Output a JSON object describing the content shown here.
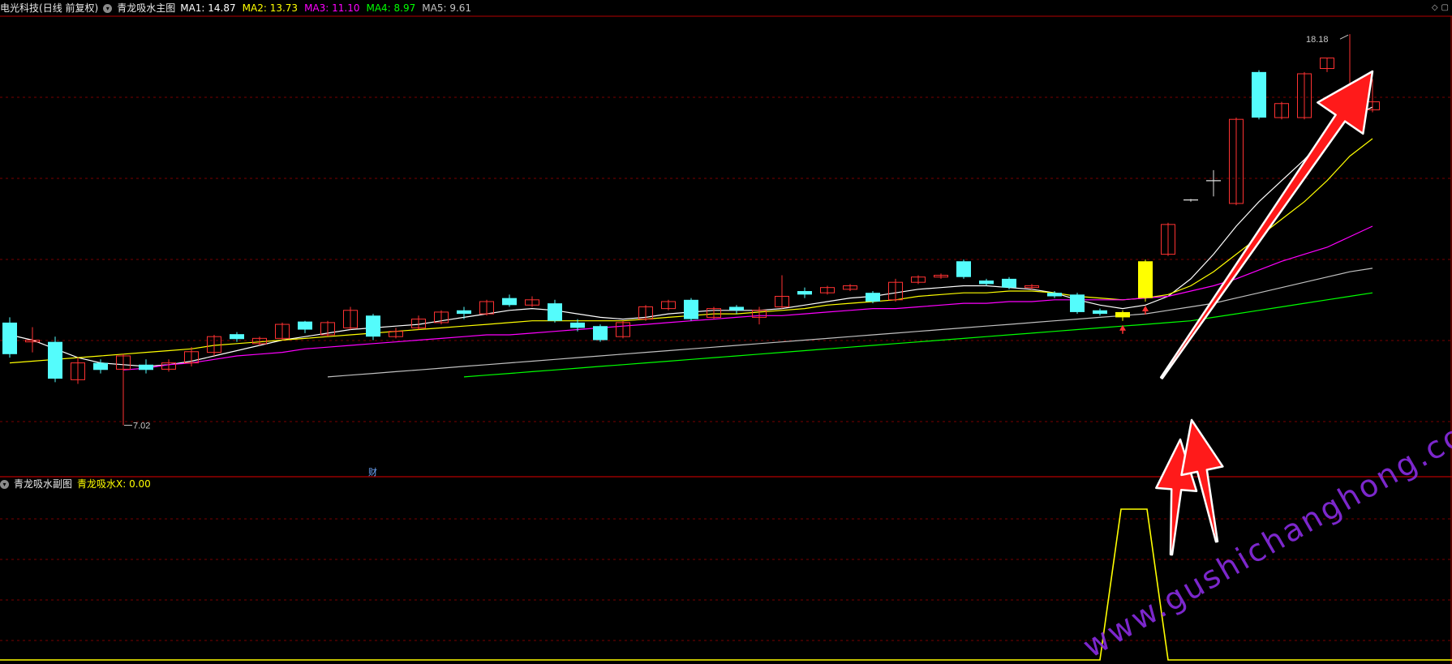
{
  "main_panel": {
    "stock_name": "电光科技",
    "period_label": "(日线 前复权)",
    "indicator_name": "青龙吸水主图",
    "ma_labels": [
      {
        "text": "MA1: 14.87",
        "color": "#ffffff"
      },
      {
        "text": "MA2: 13.73",
        "color": "#ffff00"
      },
      {
        "text": "MA3: 11.10",
        "color": "#ff00ff"
      },
      {
        "text": "MA4: 8.97",
        "color": "#00ff00"
      },
      {
        "text": "MA5: 9.61",
        "color": "#c0c0c0"
      }
    ],
    "high_label": "18.18",
    "low_label": "7.02",
    "finance_marker": "财"
  },
  "sub_panel": {
    "indicator_name": "青龙吸水副图",
    "value_label": "青龙吸水X: 0.00"
  },
  "watermark": "www.gushichanghong.com",
  "colors": {
    "up": "#ff3232",
    "down": "#54fcfc",
    "signal": "#ffff00",
    "grid": "#7a0000",
    "axis": "#b40000"
  },
  "chart_data": {
    "type": "candlestick",
    "price_range": [
      7.02,
      18.18
    ],
    "candles": [
      {
        "o": 9.05,
        "c": 9.95,
        "h": 10.1,
        "l": 8.95,
        "dir": "down"
      },
      {
        "o": 9.4,
        "c": 9.45,
        "h": 9.82,
        "l": 9.1,
        "dir": "up"
      },
      {
        "o": 9.4,
        "c": 8.35,
        "h": 9.55,
        "l": 8.25,
        "dir": "down"
      },
      {
        "o": 8.32,
        "c": 8.8,
        "h": 8.95,
        "l": 8.2,
        "dir": "up"
      },
      {
        "o": 8.8,
        "c": 8.6,
        "h": 8.9,
        "l": 8.5,
        "dir": "down"
      },
      {
        "o": 8.62,
        "c": 9.0,
        "h": 9.05,
        "l": 7.02,
        "dir": "up"
      },
      {
        "o": 8.75,
        "c": 8.6,
        "h": 8.9,
        "l": 8.5,
        "dir": "down"
      },
      {
        "o": 8.62,
        "c": 8.8,
        "h": 8.9,
        "l": 8.55,
        "dir": "up"
      },
      {
        "o": 8.8,
        "c": 9.12,
        "h": 9.25,
        "l": 8.7,
        "dir": "up"
      },
      {
        "o": 9.1,
        "c": 9.55,
        "h": 9.6,
        "l": 9.0,
        "dir": "up"
      },
      {
        "o": 9.62,
        "c": 9.48,
        "h": 9.68,
        "l": 9.4,
        "dir": "down"
      },
      {
        "o": 9.35,
        "c": 9.5,
        "h": 9.55,
        "l": 9.3,
        "dir": "up"
      },
      {
        "o": 9.5,
        "c": 9.9,
        "h": 9.95,
        "l": 9.45,
        "dir": "up"
      },
      {
        "o": 9.98,
        "c": 9.75,
        "h": 10.0,
        "l": 9.65,
        "dir": "down"
      },
      {
        "o": 9.6,
        "c": 9.95,
        "h": 10.0,
        "l": 9.55,
        "dir": "up"
      },
      {
        "o": 9.8,
        "c": 10.3,
        "h": 10.4,
        "l": 9.75,
        "dir": "up"
      },
      {
        "o": 10.15,
        "c": 9.55,
        "h": 10.2,
        "l": 9.45,
        "dir": "down"
      },
      {
        "o": 9.55,
        "c": 9.7,
        "h": 9.8,
        "l": 9.5,
        "dir": "up"
      },
      {
        "o": 9.8,
        "c": 10.05,
        "h": 10.15,
        "l": 9.75,
        "dir": "up"
      },
      {
        "o": 9.95,
        "c": 10.25,
        "h": 10.3,
        "l": 9.9,
        "dir": "up"
      },
      {
        "o": 10.3,
        "c": 10.2,
        "h": 10.4,
        "l": 10.05,
        "dir": "down"
      },
      {
        "o": 10.2,
        "c": 10.55,
        "h": 10.6,
        "l": 10.15,
        "dir": "up"
      },
      {
        "o": 10.65,
        "c": 10.45,
        "h": 10.75,
        "l": 10.4,
        "dir": "down"
      },
      {
        "o": 10.45,
        "c": 10.6,
        "h": 10.7,
        "l": 10.4,
        "dir": "up"
      },
      {
        "o": 10.5,
        "c": 10.0,
        "h": 10.6,
        "l": 9.95,
        "dir": "down"
      },
      {
        "o": 9.8,
        "c": 9.95,
        "h": 10.05,
        "l": 9.7,
        "dir": "down"
      },
      {
        "o": 9.85,
        "c": 9.45,
        "h": 9.9,
        "l": 9.4,
        "dir": "down"
      },
      {
        "o": 9.55,
        "c": 9.95,
        "h": 10.0,
        "l": 9.5,
        "dir": "up"
      },
      {
        "o": 10.05,
        "c": 10.4,
        "h": 10.45,
        "l": 10.0,
        "dir": "up"
      },
      {
        "o": 10.35,
        "c": 10.55,
        "h": 10.6,
        "l": 10.3,
        "dir": "up"
      },
      {
        "o": 10.6,
        "c": 10.05,
        "h": 10.65,
        "l": 10.0,
        "dir": "down"
      },
      {
        "o": 10.1,
        "c": 10.35,
        "h": 10.4,
        "l": 10.05,
        "dir": "up"
      },
      {
        "o": 10.4,
        "c": 10.3,
        "h": 10.45,
        "l": 10.2,
        "dir": "down"
      },
      {
        "o": 10.1,
        "c": 10.3,
        "h": 10.4,
        "l": 9.9,
        "dir": "up"
      },
      {
        "o": 10.4,
        "c": 10.7,
        "h": 11.3,
        "l": 10.35,
        "dir": "up"
      },
      {
        "o": 10.85,
        "c": 10.75,
        "h": 10.95,
        "l": 10.65,
        "dir": "down"
      },
      {
        "o": 10.8,
        "c": 10.95,
        "h": 11.0,
        "l": 10.75,
        "dir": "up"
      },
      {
        "o": 10.9,
        "c": 11.0,
        "h": 11.05,
        "l": 10.85,
        "dir": "up"
      },
      {
        "o": 10.8,
        "c": 10.55,
        "h": 10.85,
        "l": 10.5,
        "dir": "down"
      },
      {
        "o": 10.6,
        "c": 11.1,
        "h": 11.2,
        "l": 10.55,
        "dir": "up"
      },
      {
        "o": 11.1,
        "c": 11.25,
        "h": 11.3,
        "l": 11.05,
        "dir": "up"
      },
      {
        "o": 11.25,
        "c": 11.3,
        "h": 11.35,
        "l": 11.2,
        "dir": "up"
      },
      {
        "o": 11.25,
        "c": 11.7,
        "h": 11.75,
        "l": 11.2,
        "dir": "down"
      },
      {
        "o": 11.15,
        "c": 11.05,
        "h": 11.2,
        "l": 11.0,
        "dir": "down"
      },
      {
        "o": 11.2,
        "c": 10.95,
        "h": 11.25,
        "l": 10.9,
        "dir": "down"
      },
      {
        "o": 10.95,
        "c": 11.0,
        "h": 11.05,
        "l": 10.9,
        "dir": "up"
      },
      {
        "o": 10.8,
        "c": 10.7,
        "h": 10.85,
        "l": 10.65,
        "dir": "down"
      },
      {
        "o": 10.75,
        "c": 10.25,
        "h": 10.8,
        "l": 10.2,
        "dir": "down"
      },
      {
        "o": 10.3,
        "c": 10.2,
        "h": 10.35,
        "l": 10.15,
        "dir": "down"
      },
      {
        "o": 10.25,
        "c": 10.1,
        "h": 10.3,
        "l": 10.0,
        "dir": "signal"
      },
      {
        "o": 10.65,
        "c": 11.7,
        "h": 11.75,
        "l": 10.55,
        "dir": "signal"
      },
      {
        "o": 11.9,
        "c": 12.75,
        "h": 12.8,
        "l": 11.85,
        "dir": "up"
      },
      {
        "o": 13.42,
        "c": 13.45,
        "h": 13.48,
        "l": 13.4,
        "dir": "flat"
      },
      {
        "o": 13.95,
        "c": 14.0,
        "h": 14.3,
        "l": 13.55,
        "dir": "flat"
      },
      {
        "o": 13.35,
        "c": 15.75,
        "h": 15.8,
        "l": 13.3,
        "dir": "up"
      },
      {
        "o": 17.1,
        "c": 15.8,
        "h": 17.15,
        "l": 15.75,
        "dir": "down"
      },
      {
        "o": 15.8,
        "c": 16.2,
        "h": 16.25,
        "l": 15.75,
        "dir": "up"
      },
      {
        "o": 15.8,
        "c": 17.05,
        "h": 17.1,
        "l": 15.75,
        "dir": "up"
      },
      {
        "o": 17.2,
        "c": 17.5,
        "h": 17.5,
        "l": 17.1,
        "dir": "up"
      },
      {
        "o": 16.55,
        "c": 16.5,
        "h": 18.18,
        "l": 16.45,
        "dir": "up"
      },
      {
        "o": 16.02,
        "c": 16.25,
        "h": 16.9,
        "l": 15.95,
        "dir": "up"
      }
    ],
    "ma_lines": [
      {
        "name": "MA1",
        "color": "#ffffff",
        "start": 0,
        "values": [
          9.6,
          9.45,
          9.2,
          8.95,
          8.8,
          8.75,
          8.7,
          8.75,
          8.85,
          9.0,
          9.15,
          9.3,
          9.45,
          9.55,
          9.65,
          9.75,
          9.8,
          9.85,
          9.9,
          10.0,
          10.1,
          10.2,
          10.3,
          10.35,
          10.3,
          10.2,
          10.1,
          10.05,
          10.1,
          10.2,
          10.25,
          10.3,
          10.3,
          10.3,
          10.35,
          10.45,
          10.55,
          10.65,
          10.7,
          10.8,
          10.9,
          10.95,
          11.0,
          11.0,
          10.95,
          10.9,
          10.8,
          10.6,
          10.45,
          10.35,
          10.45,
          10.7,
          11.2,
          11.9,
          12.7,
          13.4,
          14.0,
          14.6,
          15.3,
          15.8,
          16.1
        ]
      },
      {
        "name": "MA2",
        "color": "#ffff00",
        "start": 0,
        "values": [
          8.8,
          8.85,
          8.9,
          8.95,
          9.0,
          9.05,
          9.1,
          9.15,
          9.2,
          9.3,
          9.35,
          9.4,
          9.45,
          9.5,
          9.55,
          9.6,
          9.65,
          9.7,
          9.75,
          9.8,
          9.85,
          9.9,
          9.95,
          10.0,
          10.0,
          10.0,
          10.0,
          10.0,
          10.05,
          10.1,
          10.15,
          10.2,
          10.2,
          10.25,
          10.3,
          10.35,
          10.45,
          10.5,
          10.55,
          10.6,
          10.7,
          10.75,
          10.8,
          10.8,
          10.85,
          10.85,
          10.8,
          10.7,
          10.65,
          10.6,
          10.65,
          10.75,
          11.0,
          11.4,
          11.9,
          12.4,
          12.9,
          13.4,
          14.0,
          14.7,
          15.2
        ]
      },
      {
        "name": "MA3",
        "color": "#ff00ff",
        "start": 5,
        "values": [
          8.6,
          8.65,
          8.75,
          8.8,
          8.9,
          9.0,
          9.05,
          9.1,
          9.2,
          9.25,
          9.3,
          9.35,
          9.4,
          9.45,
          9.5,
          9.55,
          9.6,
          9.6,
          9.65,
          9.7,
          9.75,
          9.8,
          9.85,
          9.9,
          9.95,
          10.0,
          10.05,
          10.1,
          10.15,
          10.15,
          10.2,
          10.25,
          10.3,
          10.35,
          10.35,
          10.4,
          10.45,
          10.5,
          10.5,
          10.55,
          10.55,
          10.6,
          10.6,
          10.6,
          10.6,
          10.65,
          10.7,
          10.85,
          11.0,
          11.2,
          11.45,
          11.7,
          11.9,
          12.1,
          12.4,
          12.7
        ]
      },
      {
        "name": "MA5",
        "color": "#c0c0c0",
        "start": 14,
        "values": [
          8.4,
          8.45,
          8.5,
          8.55,
          8.6,
          8.65,
          8.7,
          8.75,
          8.8,
          8.85,
          8.9,
          8.95,
          9.0,
          9.05,
          9.1,
          9.15,
          9.2,
          9.25,
          9.3,
          9.35,
          9.4,
          9.45,
          9.5,
          9.55,
          9.6,
          9.65,
          9.7,
          9.75,
          9.8,
          9.85,
          9.9,
          9.95,
          10.0,
          10.05,
          10.1,
          10.15,
          10.2,
          10.3,
          10.4,
          10.5,
          10.65,
          10.8,
          10.95,
          11.1,
          11.25,
          11.4,
          11.5
        ]
      },
      {
        "name": "MA4",
        "color": "#00ff00",
        "start": 20,
        "values": [
          8.4,
          8.45,
          8.5,
          8.55,
          8.6,
          8.65,
          8.7,
          8.75,
          8.8,
          8.85,
          8.9,
          8.95,
          9.0,
          9.05,
          9.1,
          9.15,
          9.2,
          9.25,
          9.3,
          9.35,
          9.4,
          9.45,
          9.5,
          9.55,
          9.6,
          9.65,
          9.7,
          9.75,
          9.8,
          9.85,
          9.9,
          9.95,
          10.0,
          10.1,
          10.2,
          10.3,
          10.4,
          10.5,
          10.6,
          10.7,
          10.8
        ]
      }
    ],
    "sub_values": {
      "baseline": 0.0,
      "pulse_candles": [
        49,
        50
      ],
      "pulse_level": 1.0
    }
  }
}
